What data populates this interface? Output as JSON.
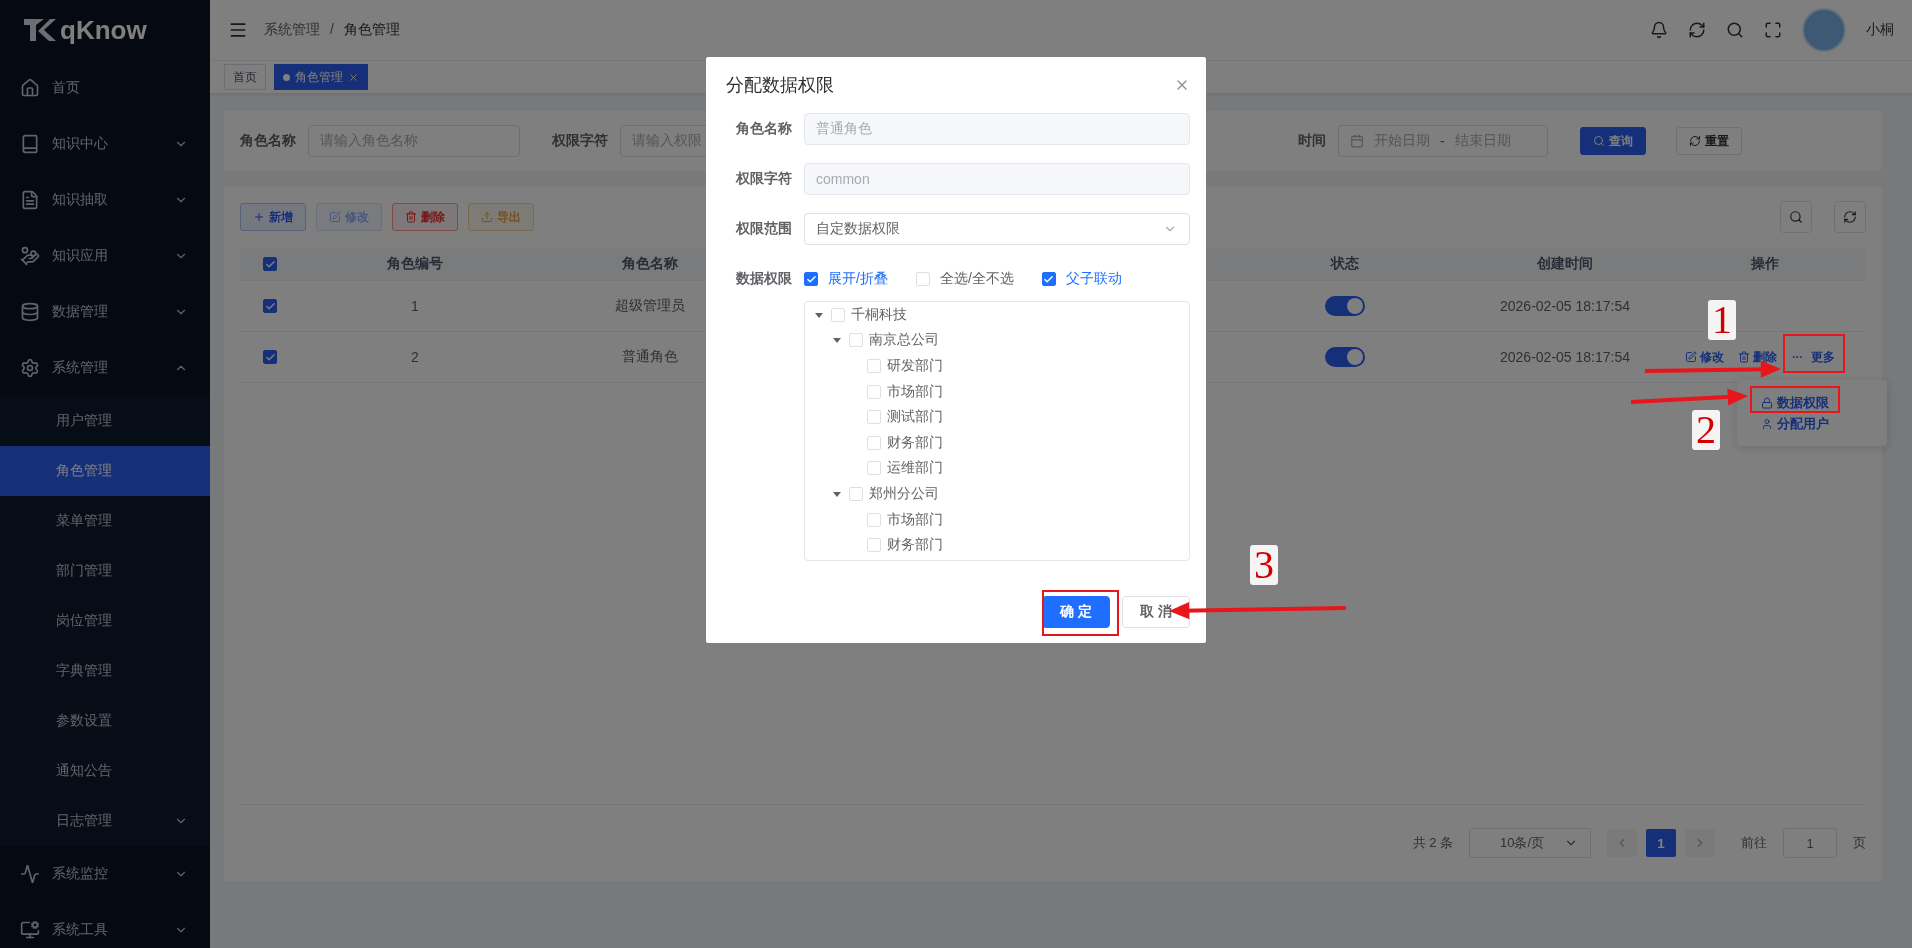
{
  "sidebar": {
    "logo": "qKnow",
    "items": [
      {
        "label": "首页",
        "selected": false
      },
      {
        "label": "知识中心",
        "selected": false,
        "expanded": false
      },
      {
        "label": "知识抽取",
        "selected": false,
        "expanded": false
      },
      {
        "label": "知识应用",
        "selected": false,
        "expanded": false
      },
      {
        "label": "数据管理",
        "selected": false,
        "expanded": false
      },
      {
        "label": "系统管理",
        "selected": false,
        "expanded": true,
        "children": [
          {
            "label": "用户管理",
            "selected": false
          },
          {
            "label": "角色管理",
            "selected": true
          },
          {
            "label": "菜单管理",
            "selected": false
          },
          {
            "label": "部门管理",
            "selected": false
          },
          {
            "label": "岗位管理",
            "selected": false
          },
          {
            "label": "字典管理",
            "selected": false
          },
          {
            "label": "参数设置",
            "selected": false
          },
          {
            "label": "通知公告",
            "selected": false
          },
          {
            "label": "日志管理",
            "selected": false,
            "expanded": false
          }
        ]
      },
      {
        "label": "系统监控",
        "selected": false,
        "expanded": false
      },
      {
        "label": "系统工具",
        "selected": false,
        "expanded": false
      }
    ]
  },
  "header": {
    "breadcrumb": [
      "系统管理",
      "角色管理"
    ],
    "separator": "/",
    "user": "小桐"
  },
  "tags": [
    {
      "label": "首页",
      "selected": false
    },
    {
      "label": "角色管理",
      "selected": true
    }
  ],
  "filters": [
    {
      "label": "角色名称",
      "placeholder": "请输入角色名称"
    },
    {
      "label": "权限字符",
      "placeholder": "请输入权限"
    },
    {
      "label": "时间",
      "start_placeholder": "开始日期",
      "separator": "-",
      "end_placeholder": "结束日期"
    }
  ],
  "filter_buttons": [
    {
      "label": "查询",
      "kind": "primary"
    },
    {
      "label": "重置",
      "kind": "default"
    }
  ],
  "toolbar": [
    {
      "label": "新增",
      "kind": "primary",
      "disabled": false
    },
    {
      "label": "修改",
      "kind": "success",
      "disabled": true
    },
    {
      "label": "删除",
      "kind": "danger",
      "disabled": false
    },
    {
      "label": "导出",
      "kind": "warning",
      "disabled": false
    }
  ],
  "table": {
    "all_checked": true,
    "columns": [
      "角色编号",
      "角色名称",
      "状态",
      "创建时间",
      "操作"
    ],
    "rows": [
      {
        "checked": true,
        "id": "1",
        "name": "超级管理员",
        "on": true,
        "created": "2026-02-05 18:17:54",
        "actions": []
      },
      {
        "checked": true,
        "id": "2",
        "name": "普通角色",
        "on": true,
        "created": "2026-02-05 18:17:54",
        "actions": [
          {
            "label": "修改",
            "kind": "edit"
          },
          {
            "label": "删除",
            "kind": "delete"
          },
          {
            "label": "更多",
            "kind": "more"
          }
        ]
      }
    ]
  },
  "more_menu": [
    {
      "label": "数据权限",
      "kind": "lock"
    },
    {
      "label": "分配用户",
      "kind": "user"
    }
  ],
  "pagination": {
    "total": "共 2 条",
    "page_size": "10条/页",
    "pages": [
      {
        "label": "1",
        "selected": true
      }
    ],
    "goto_label": "前往",
    "goto_value": "1",
    "goto_suffix": "页"
  },
  "dialog": {
    "title": "分配数据权限",
    "fields": [
      {
        "label": "角色名称",
        "value": "普通角色",
        "kind": "readonly"
      },
      {
        "label": "权限字符",
        "value": "common",
        "kind": "readonly"
      },
      {
        "label": "权限范围",
        "value": "自定数据权限",
        "kind": "select"
      }
    ],
    "scope_label": "数据权限",
    "options": [
      {
        "label": "展开/折叠",
        "checked": true
      },
      {
        "label": "全选/全不选",
        "checked": false
      },
      {
        "label": "父子联动",
        "checked": true
      }
    ],
    "tree": [
      {
        "label": "千桐科技",
        "checked": false,
        "expanded": true,
        "children": [
          {
            "label": "南京总公司",
            "checked": false,
            "expanded": true,
            "children": [
              {
                "label": "研发部门",
                "checked": false
              },
              {
                "label": "市场部门",
                "checked": false
              },
              {
                "label": "测试部门",
                "checked": false
              },
              {
                "label": "财务部门",
                "checked": false
              },
              {
                "label": "运维部门",
                "checked": false
              }
            ]
          },
          {
            "label": "郑州分公司",
            "checked": false,
            "expanded": true,
            "children": [
              {
                "label": "市场部门",
                "checked": false
              },
              {
                "label": "财务部门",
                "checked": false
              }
            ]
          }
        ]
      }
    ],
    "buttons": [
      {
        "label": "确 定",
        "kind": "primary"
      },
      {
        "label": "取 消",
        "kind": "default"
      }
    ]
  },
  "annotations": [
    {
      "number": "1"
    },
    {
      "number": "2"
    },
    {
      "number": "3"
    }
  ]
}
